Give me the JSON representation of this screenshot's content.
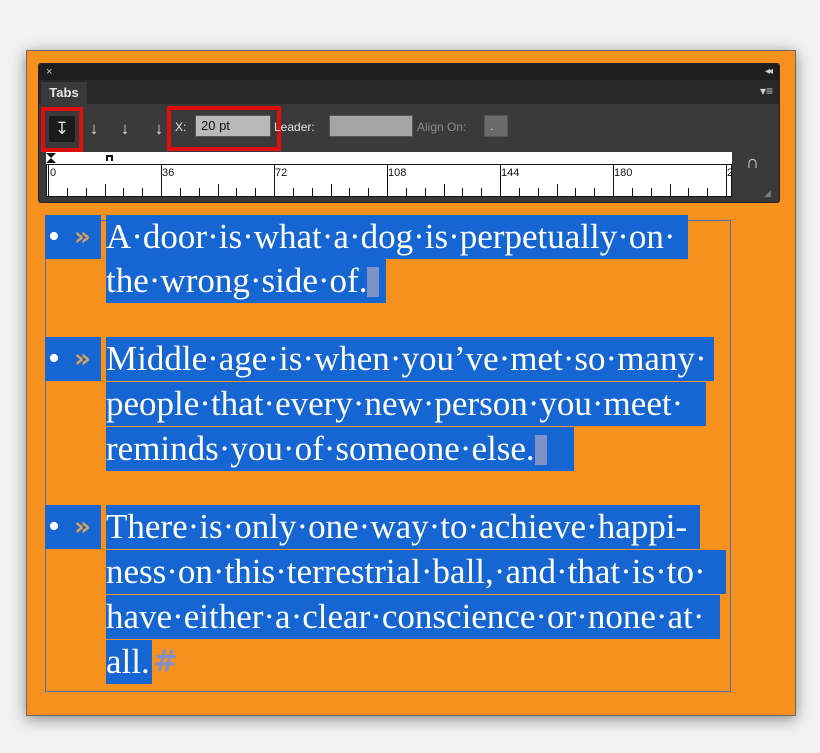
{
  "panel": {
    "close_glyph": "×",
    "collapse_glyph": "◂◂",
    "menu_glyph": "▾≡",
    "tab_title": "Tabs",
    "x_label": "X:",
    "x_value": "20 pt",
    "leader_label": "Leader:",
    "leader_value": "",
    "align_on_label": "Align On:",
    "align_on_value": ".",
    "buttons": {
      "left_justified": "↧",
      "center_justified": "↓",
      "right_justified": "↓",
      "align_to_decimal": "↓"
    }
  },
  "ruler": {
    "labels": [
      "0",
      "36",
      "72",
      "108",
      "144",
      "180",
      "2"
    ]
  },
  "story": {
    "paragraphs": [
      {
        "bullet": "•",
        "tab_marker": "»",
        "lines": [
          "A·door·is·what·a·dog·is·perpetually·on·",
          "the·wrong·side·of."
        ]
      },
      {
        "bullet": "•",
        "tab_marker": "»",
        "lines": [
          "Middle·age·is·when·you’ve·met·so·many·",
          "people·that·every·new·person·you·meet·",
          "reminds·you·of·someone·else."
        ]
      },
      {
        "bullet": "•",
        "tab_marker": "»",
        "lines": [
          "There·is·only·one·way·to·achieve·happi-",
          "ness·on·this·terrestrial·ball,·and·that·is·to·",
          "have·either·a·clear·conscience·or·none·at·",
          "all."
        ]
      }
    ],
    "end_of_story_mark": "#"
  },
  "colors": {
    "document_bg": "#f6911e",
    "selection": "#1565d2",
    "highlight_box": "#e00d0d",
    "panel_bg": "#3a3a3a"
  }
}
